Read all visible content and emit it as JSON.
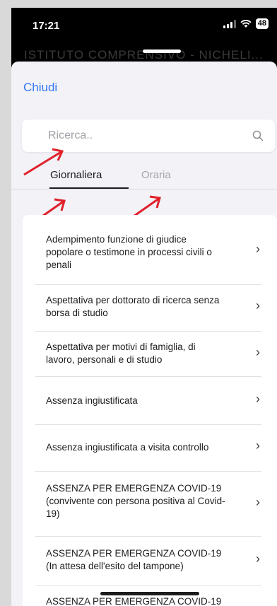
{
  "status_bar": {
    "time": "17:21",
    "battery": "48"
  },
  "background_title": "ISTITUTO COMPRENSIVO - NICHELI...",
  "sheet": {
    "close_label": "Chiudi"
  },
  "search": {
    "placeholder": "Ricerca.."
  },
  "tabs": [
    {
      "label": "Giornaliera",
      "selected": true
    },
    {
      "label": "Oraria",
      "selected": false
    }
  ],
  "list": {
    "items": [
      {
        "label": "Adempimento funzione di giudice popolare o  testimone in processi civili o penali"
      },
      {
        "label": "Aspettativa per dottorato di ricerca senza borsa di studio"
      },
      {
        "label": "Aspettativa per motivi di famiglia, di lavoro, personali e di studio"
      },
      {
        "label": "Assenza ingiustificata"
      },
      {
        "label": "Assenza ingiustificata a visita controllo"
      },
      {
        "label": "ASSENZA PER EMERGENZA COVID-19 (convivente con persona positiva al Covid-19)"
      },
      {
        "label": "ASSENZA PER EMERGENZA COVID-19 (In attesa dell'esito del tampone)"
      },
      {
        "label": "ASSENZA PER EMERGENZA COVID-19"
      }
    ]
  },
  "colors": {
    "accent": "#3478f6",
    "annotation_arrow": "#e0202a"
  },
  "icons": {
    "chevron": "chevron-right-icon",
    "search": "search-icon"
  }
}
